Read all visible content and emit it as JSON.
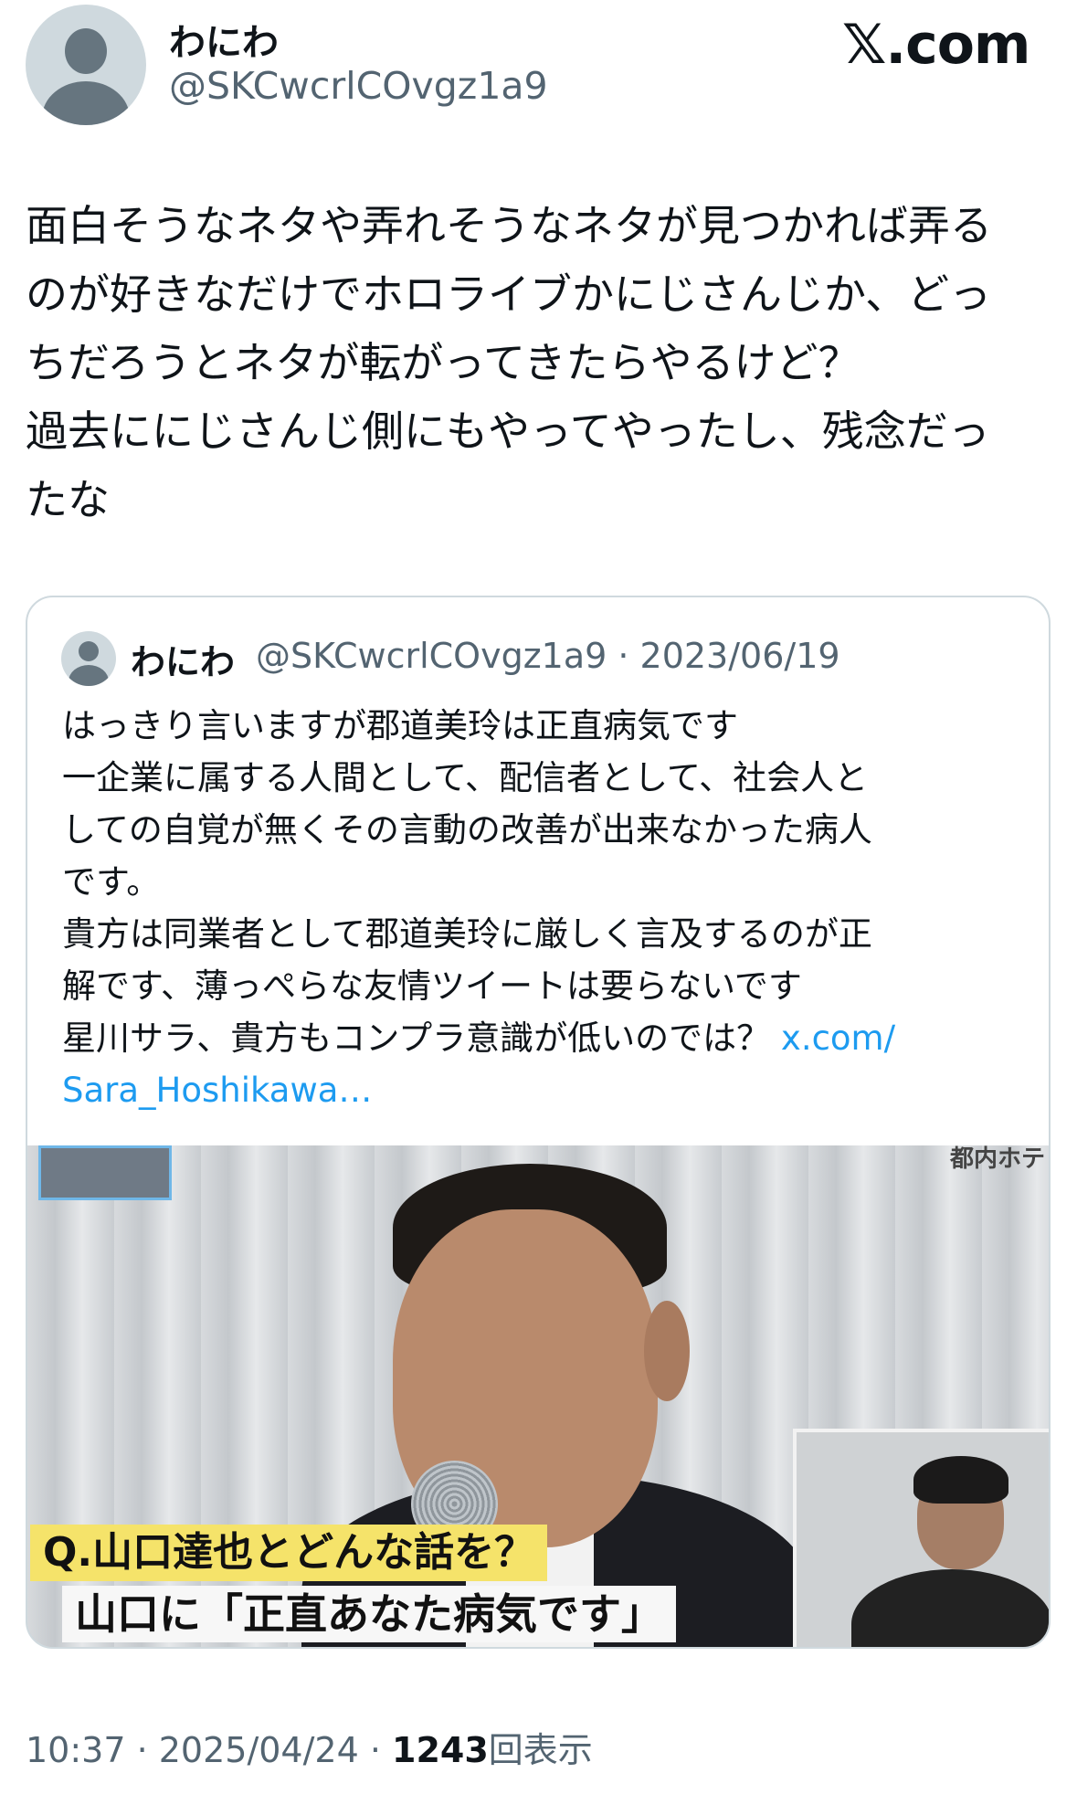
{
  "author": {
    "display_name": "わにわ",
    "handle": "@SKCwcrlCOvgz1a9"
  },
  "brand": {
    "logo_text": "𝕏.com"
  },
  "post": {
    "text": "面白そうなネタや弄れそうなネタが見つかれば弄る\nのが好きなだけでホロライブかにじさんじか、どっ\nちだろうとネタが転がってきたらやるけど？\n過去ににじさんじ側にもやってやったし、残念だっ\nたな"
  },
  "quoted": {
    "display_name": "わにわ",
    "meta": "@SKCwcrlCOvgz1a9 · 2023/06/19",
    "text": "はっきり言いますが郡道美玲は正直病気です\n一企業に属する人間として、配信者として、社会人と\nしての自覚が無くその言動の改善が出来なかった病人\nです。\n貴方は同業者として郡道美玲に厳しく言及するのが正\n解です、薄っぺらな友情ツイートは要らないです\n星川サラ、貴方もコンプラ意識が低いのでは？ ",
    "link_text": "x.com/\nSara_Hoshikawa…",
    "media": {
      "caption_line1": "Q.山口達也とどんな話を？",
      "caption_line2": "山口に「正直あなた病気です」",
      "corner_text": "都内ホテ"
    }
  },
  "footer": {
    "time_date": "10:37 · 2025/04/24 · ",
    "view_count": "1243",
    "view_label": "回表示"
  },
  "colors": {
    "text": "#0f1419",
    "secondary": "#536471",
    "link": "#1d9bf0",
    "border": "#cfd9de"
  }
}
